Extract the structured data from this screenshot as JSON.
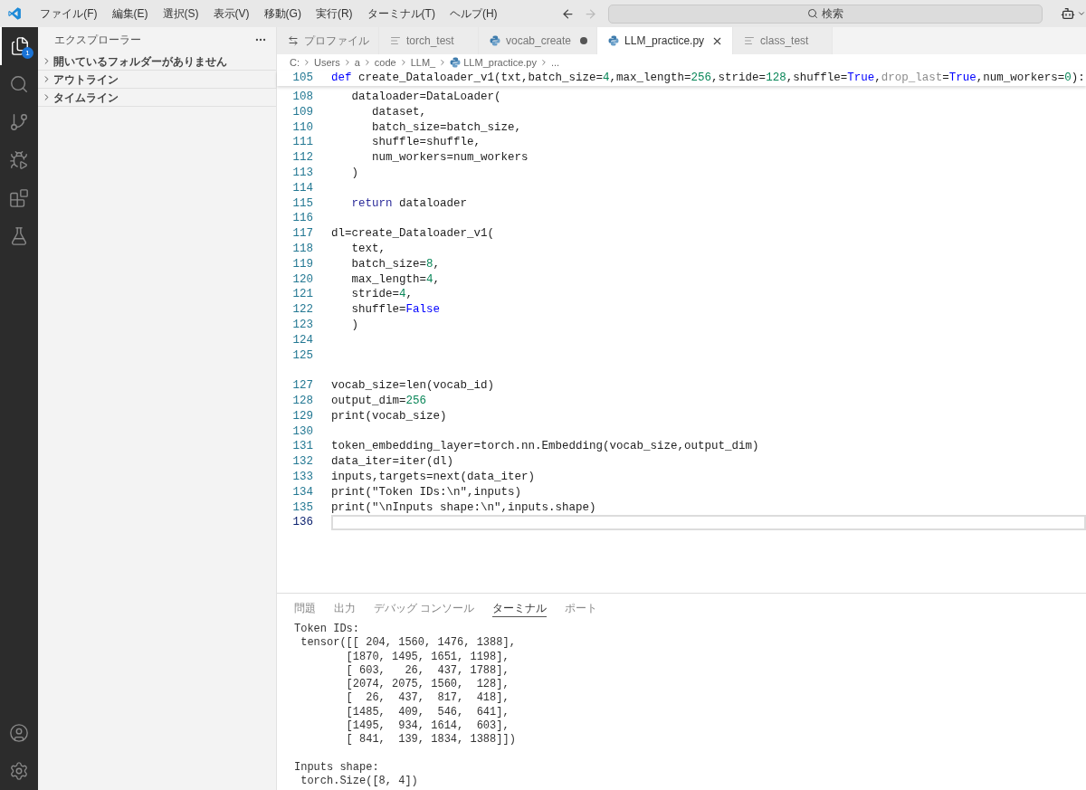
{
  "title_bar": {
    "menu": [
      "ファイル(F)",
      "編集(E)",
      "選択(S)",
      "表示(V)",
      "移動(G)",
      "実行(R)",
      "ターミナル(T)",
      "ヘルプ(H)"
    ],
    "back_disabled": false,
    "forward_disabled": true,
    "search": {
      "label": "検索"
    }
  },
  "activity_bar": {
    "items": [
      {
        "kind": "explorer",
        "selected": true,
        "badge": "1"
      },
      {
        "kind": "search",
        "selected": false
      },
      {
        "kind": "source_control",
        "selected": false
      },
      {
        "kind": "run_debug",
        "selected": false
      },
      {
        "kind": "extensions",
        "selected": false
      },
      {
        "kind": "testing",
        "selected": false
      }
    ],
    "bottom": [
      {
        "kind": "accounts"
      },
      {
        "kind": "settings"
      }
    ]
  },
  "sidebar": {
    "title": "エクスプローラー",
    "sections": [
      {
        "label": "開いているフォルダーがありません",
        "expanded": false
      },
      {
        "label": "アウトライン",
        "expanded": false
      },
      {
        "label": "タイムライン",
        "expanded": false
      }
    ]
  },
  "tabs": [
    {
      "label": "プロファイル",
      "kind": "profile",
      "selected": false,
      "modified": false
    },
    {
      "label": "torch_test",
      "kind": "text",
      "selected": false,
      "modified": false
    },
    {
      "label": "vocab_create",
      "kind": "python",
      "selected": false,
      "modified": true
    },
    {
      "label": "LLM_practice.py",
      "kind": "python",
      "selected": true,
      "modified": false
    },
    {
      "label": "class_test",
      "kind": "text",
      "selected": false,
      "modified": false
    }
  ],
  "breadcrumb": [
    {
      "label": "C:",
      "kind": "folder"
    },
    {
      "label": "Users",
      "kind": "folder"
    },
    {
      "label": "a",
      "kind": "folder"
    },
    {
      "label": "code",
      "kind": "folder"
    },
    {
      "label": "LLM_",
      "kind": "folder"
    },
    {
      "label": "LLM_practice.py",
      "kind": "python"
    },
    {
      "label": "...",
      "kind": "more"
    }
  ],
  "editor": {
    "sticky_line": {
      "number": "105",
      "tokens": [
        {
          "text": "def",
          "kind": "keyword"
        },
        {
          "text": " create_Dataloader_v1(txt,batch_size=",
          "kind": "plain"
        },
        {
          "text": "4",
          "kind": "number"
        },
        {
          "text": ",max_length=",
          "kind": "plain"
        },
        {
          "text": "256",
          "kind": "number"
        },
        {
          "text": ",stride=",
          "kind": "plain"
        },
        {
          "text": "128",
          "kind": "number"
        },
        {
          "text": ",shuffle=",
          "kind": "plain"
        },
        {
          "text": "True",
          "kind": "constant"
        },
        {
          "text": ",",
          "kind": "plain"
        },
        {
          "text": "drop_last",
          "kind": "dim"
        },
        {
          "text": "=",
          "kind": "plain"
        },
        {
          "text": "True",
          "kind": "constant"
        },
        {
          "text": ",num_workers=",
          "kind": "plain"
        },
        {
          "text": "0",
          "kind": "number"
        },
        {
          "text": "):",
          "kind": "plain"
        }
      ]
    },
    "lines": [
      {
        "number": "108",
        "current": false,
        "tokens": [
          {
            "text": "   dataloader=DataLoader(",
            "kind": "plain"
          }
        ]
      },
      {
        "number": "109",
        "current": false,
        "tokens": [
          {
            "text": "      dataset,",
            "kind": "plain"
          }
        ]
      },
      {
        "number": "110",
        "current": false,
        "tokens": [
          {
            "text": "      batch_size=batch_size,",
            "kind": "plain"
          }
        ]
      },
      {
        "number": "111",
        "current": false,
        "tokens": [
          {
            "text": "      shuffle=shuffle,",
            "kind": "plain"
          }
        ]
      },
      {
        "number": "112",
        "current": false,
        "tokens": [
          {
            "text": "      num_workers=num_workers",
            "kind": "plain"
          }
        ]
      },
      {
        "number": "113",
        "current": false,
        "tokens": [
          {
            "text": "   )",
            "kind": "plain"
          }
        ]
      },
      {
        "number": "114",
        "current": false
      },
      {
        "number": "115",
        "current": false,
        "tokens": [
          {
            "text": "   return",
            "kind": "control"
          },
          {
            "text": " dataloader",
            "kind": "plain"
          }
        ]
      },
      {
        "number": "116",
        "current": false
      },
      {
        "number": "117",
        "current": false,
        "tokens": [
          {
            "text": "dl=create_Dataloader_v1(",
            "kind": "plain"
          }
        ]
      },
      {
        "number": "118",
        "current": false,
        "tokens": [
          {
            "text": "   text,",
            "kind": "plain"
          }
        ]
      },
      {
        "number": "119",
        "current": false,
        "tokens": [
          {
            "text": "   batch_size=",
            "kind": "plain"
          },
          {
            "text": "8",
            "kind": "number"
          },
          {
            "text": ",",
            "kind": "plain"
          }
        ]
      },
      {
        "number": "120",
        "current": false,
        "tokens": [
          {
            "text": "   max_length=",
            "kind": "plain"
          },
          {
            "text": "4",
            "kind": "number"
          },
          {
            "text": ",",
            "kind": "plain"
          }
        ]
      },
      {
        "number": "121",
        "current": false,
        "tokens": [
          {
            "text": "   stride=",
            "kind": "plain"
          },
          {
            "text": "4",
            "kind": "number"
          },
          {
            "text": ",",
            "kind": "plain"
          }
        ]
      },
      {
        "number": "122",
        "current": false,
        "tokens": [
          {
            "text": "   shuffle=",
            "kind": "plain"
          },
          {
            "text": "False",
            "kind": "constant"
          }
        ]
      },
      {
        "number": "123",
        "current": false,
        "tokens": [
          {
            "text": "   )",
            "kind": "plain"
          }
        ]
      },
      {
        "number": "124",
        "current": false
      },
      {
        "number": "125",
        "current": false
      },
      {
        "current": false
      },
      {
        "number": "127",
        "current": false,
        "tokens": [
          {
            "text": "vocab_size=len(vocab_id)",
            "kind": "plain"
          }
        ]
      },
      {
        "number": "128",
        "current": false,
        "tokens": [
          {
            "text": "output_dim=",
            "kind": "plain"
          },
          {
            "text": "256",
            "kind": "number"
          }
        ]
      },
      {
        "number": "129",
        "current": false,
        "tokens": [
          {
            "text": "print(vocab_size)",
            "kind": "plain"
          }
        ]
      },
      {
        "number": "130",
        "current": false
      },
      {
        "number": "131",
        "current": false,
        "tokens": [
          {
            "text": "token_embedding_layer=torch.nn.Embedding(vocab_size,output_dim)",
            "kind": "plain"
          }
        ]
      },
      {
        "number": "132",
        "current": false,
        "tokens": [
          {
            "text": "data_iter=iter(dl)",
            "kind": "plain"
          }
        ]
      },
      {
        "number": "133",
        "current": false,
        "tokens": [
          {
            "text": "inputs,targets=next(data_iter)",
            "kind": "plain"
          }
        ]
      },
      {
        "number": "134",
        "current": false,
        "tokens": [
          {
            "text": "print(\"Token IDs:\\n\",inputs)",
            "kind": "plain"
          }
        ]
      },
      {
        "number": "135",
        "current": false,
        "tokens": [
          {
            "text": "print(\"\\nInputs shape:\\n\",inputs.shape)",
            "kind": "plain"
          }
        ]
      },
      {
        "number": "136",
        "current": true
      }
    ]
  },
  "panel": {
    "tabs": [
      {
        "label": "問題",
        "selected": false
      },
      {
        "label": "出力",
        "selected": false
      },
      {
        "label": "デバッグ コンソール",
        "selected": false
      },
      {
        "label": "ターミナル",
        "selected": true
      },
      {
        "label": "ポート",
        "selected": false
      }
    ],
    "terminal": [
      [
        "Token IDs:",
        " tensor([[ 204, 1560, 1476, 1388],",
        "        [1870, 1495, 1651, 1198],",
        "        [ 603,   26,  437, 1788],",
        "        [2074, 2075, 1560,  128],",
        "        [  26,  437,  817,  418],",
        "        [1485,  409,  546,  641],",
        "        [1495,  934, 1614,  603],",
        "        [ 841,  139, 1834, 1388]])"
      ],
      [
        "Inputs shape:",
        " torch.Size([8, 4])"
      ]
    ]
  }
}
